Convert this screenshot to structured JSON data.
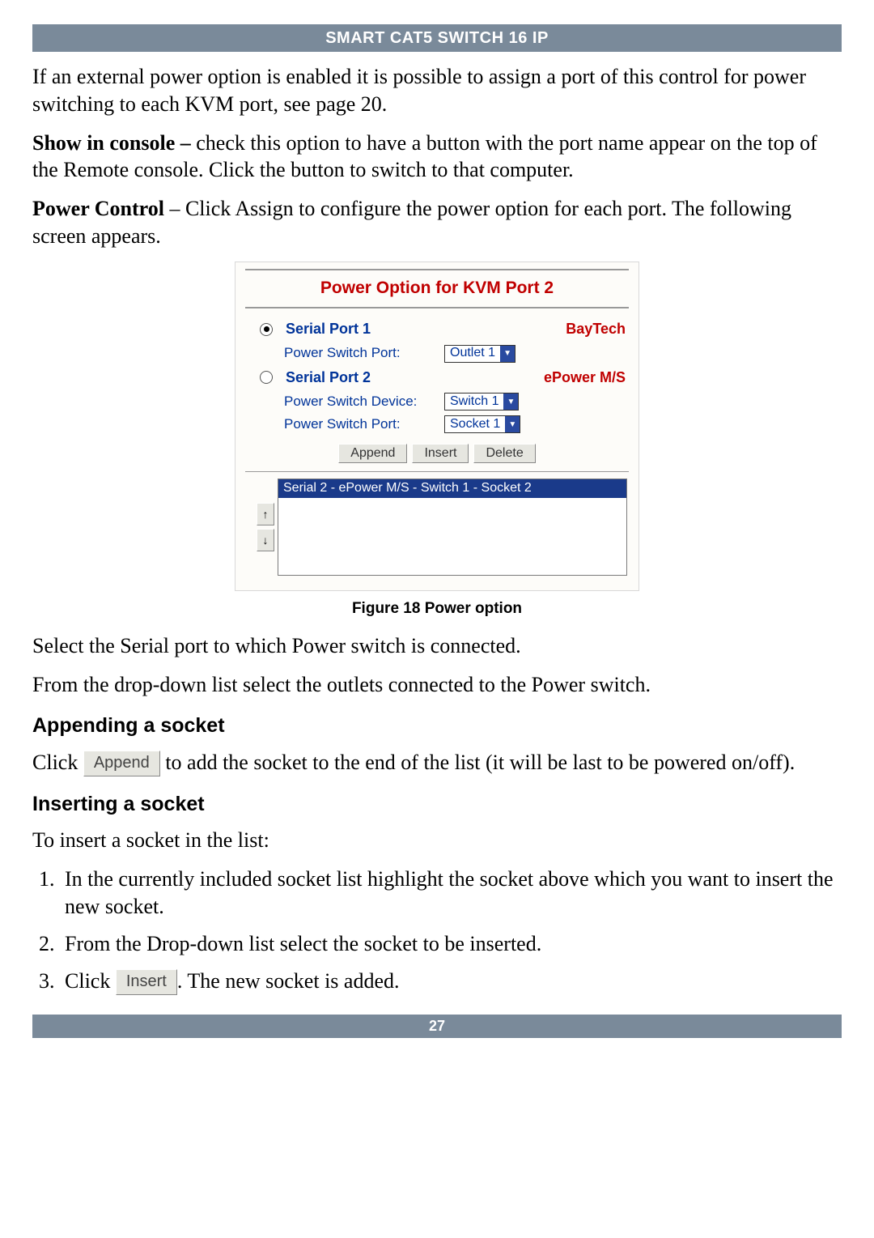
{
  "header": {
    "title": "SMART CAT5 SWITCH 16 IP"
  },
  "para1": "If an external power option is enabled it is possible to assign a port of this control for power switching to each KVM port, see page 20.",
  "para2_bold": "Show in console –",
  "para2_rest": " check this option to have a button with the port name appear on the top of the Remote console. Click the button to switch to that computer.",
  "para3_bold": "Power Control",
  "para3_rest": " – Click Assign to configure the power option for each port. The following screen appears.",
  "dialog": {
    "title": "Power Option for KVM Port 2",
    "port1": {
      "label": "Serial Port 1",
      "brand": "BayTech",
      "psp_label": "Power Switch Port:",
      "psp_value": "Outlet 1"
    },
    "port2": {
      "label": "Serial Port 2",
      "brand": "ePower M/S",
      "psd_label": "Power Switch Device:",
      "psd_value": "Switch 1",
      "psp_label": "Power Switch Port:",
      "psp_value": "Socket 1"
    },
    "buttons": {
      "append": "Append",
      "insert": "Insert",
      "delete": "Delete"
    },
    "list_item": "Serial 2 - ePower M/S - Switch 1 - Socket 2",
    "arrows": {
      "up": "↑",
      "down": "↓"
    }
  },
  "figure_caption": "Figure 18 Power option",
  "para4": "Select the Serial port to which Power switch is connected.",
  "para5": "From the drop-down list select the outlets connected to the Power switch.",
  "section_append": "Appending a socket",
  "append_p_pre": "Click ",
  "append_btn": "Append",
  "append_p_post": " to add the socket to the end of the list (it will be last to be powered on/off).",
  "section_insert": "Inserting a socket",
  "insert_intro": "To insert a socket in the list:",
  "insert_li1": "In the currently included socket list highlight the socket above which you want to insert the new socket.",
  "insert_li2": "From the Drop-down list select the socket to be inserted.",
  "insert_li3_pre": "Click ",
  "insert_btn": "Insert",
  "insert_li3_post": ". The new socket is added.",
  "footer": {
    "page": "27"
  }
}
